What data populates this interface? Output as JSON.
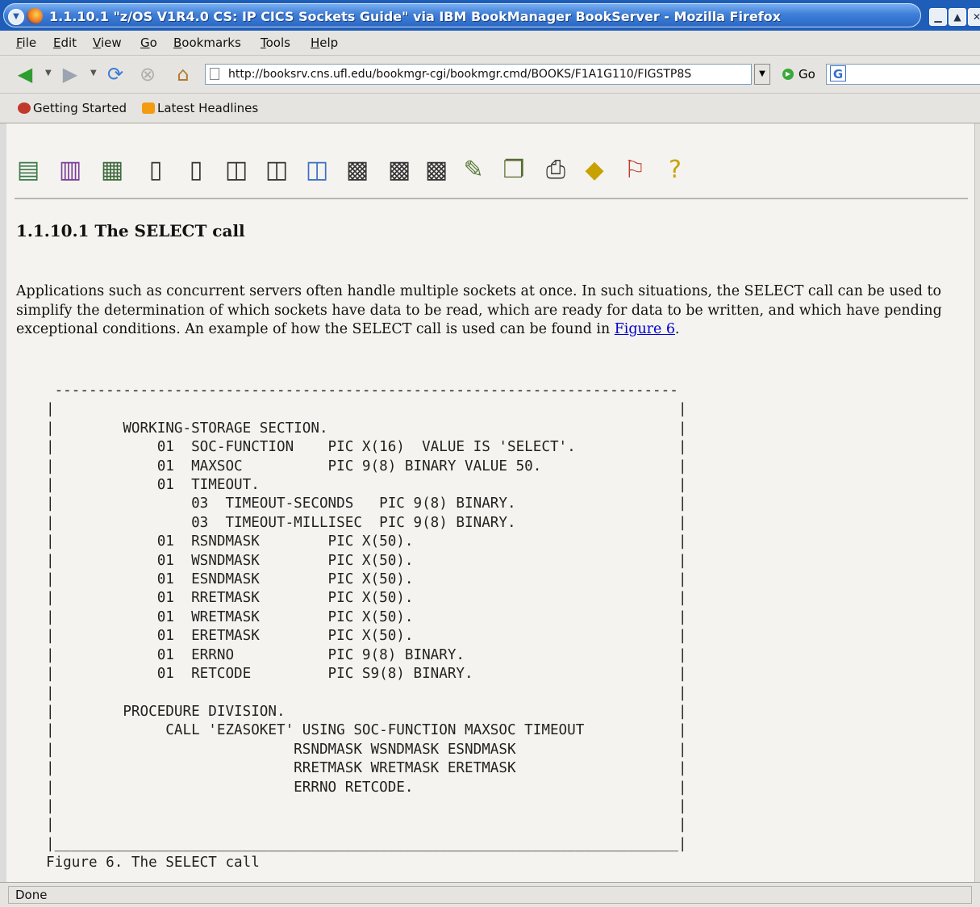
{
  "window": {
    "title": "1.1.10.1 \"z/OS V1R4.0 CS: IP CICS Sockets Guide\" via IBM BookManager BookServer - Mozilla Firefox"
  },
  "menubar": {
    "items": [
      {
        "label": "File",
        "u": "F",
        "rest": "ile"
      },
      {
        "label": "Edit",
        "u": "E",
        "rest": "dit"
      },
      {
        "label": "View",
        "u": "V",
        "rest": "iew"
      },
      {
        "label": "Go",
        "u": "G",
        "rest": "o"
      },
      {
        "label": "Bookmarks",
        "u": "B",
        "rest": "ookmarks"
      },
      {
        "label": "Tools",
        "u": "T",
        "rest": "ools"
      },
      {
        "label": "Help",
        "u": "H",
        "rest": "elp"
      }
    ]
  },
  "navigation": {
    "url": "http://booksrv.cns.ufl.edu/bookmgr-cgi/bookmgr.cmd/BOOKS/F1A1G110/FIGSTP8S",
    "go_label": "Go"
  },
  "bookmarks": {
    "items": [
      "Getting Started",
      "Latest Headlines"
    ]
  },
  "page": {
    "title": "1.1.10.1 The SELECT call",
    "paragraph": "Applications such as concurrent servers often handle multiple sockets at once. In such situations, the SELECT call can be used to simplify the determination of which sockets have data to be read, which are ready for data to be written, and which have pending exceptional conditions. An example of how the SELECT call is used can be found in ",
    "link_text": "Figure 6",
    "paragraph_end": ".",
    "figure_caption": "Figure 6. The SELECT call",
    "code_lines": [
      "        WORKING-STORAGE SECTION.",
      "            01  SOC-FUNCTION    PIC X(16)  VALUE IS 'SELECT'.",
      "            01  MAXSOC          PIC 9(8) BINARY VALUE 50.",
      "            01  TIMEOUT.",
      "                03  TIMEOUT-SECONDS   PIC 9(8) BINARY.",
      "                03  TIMEOUT-MILLISEC  PIC 9(8) BINARY.",
      "            01  RSNDMASK        PIC X(50).",
      "            01  WSNDMASK        PIC X(50).",
      "            01  ESNDMASK        PIC X(50).",
      "            01  RRETMASK        PIC X(50).",
      "            01  WRETMASK        PIC X(50).",
      "            01  ERETMASK        PIC X(50).",
      "            01  ERRNO           PIC 9(8) BINARY.",
      "            01  RETCODE         PIC S9(8) BINARY.",
      "",
      "        PROCEDURE DIVISION.",
      "             CALL 'EZASOKET' USING SOC-FUNCTION MAXSOC TIMEOUT",
      "                            RSNDMASK WSNDMASK ESNDMASK",
      "                            RRETMASK WRETMASK ERETMASK",
      "                            ERRNO RETCODE."
    ]
  },
  "status": {
    "text": "Done"
  },
  "colors": {
    "titlebar": "#3e7fd8",
    "link": "#0000cc",
    "page_background": "#f4f3ef"
  }
}
